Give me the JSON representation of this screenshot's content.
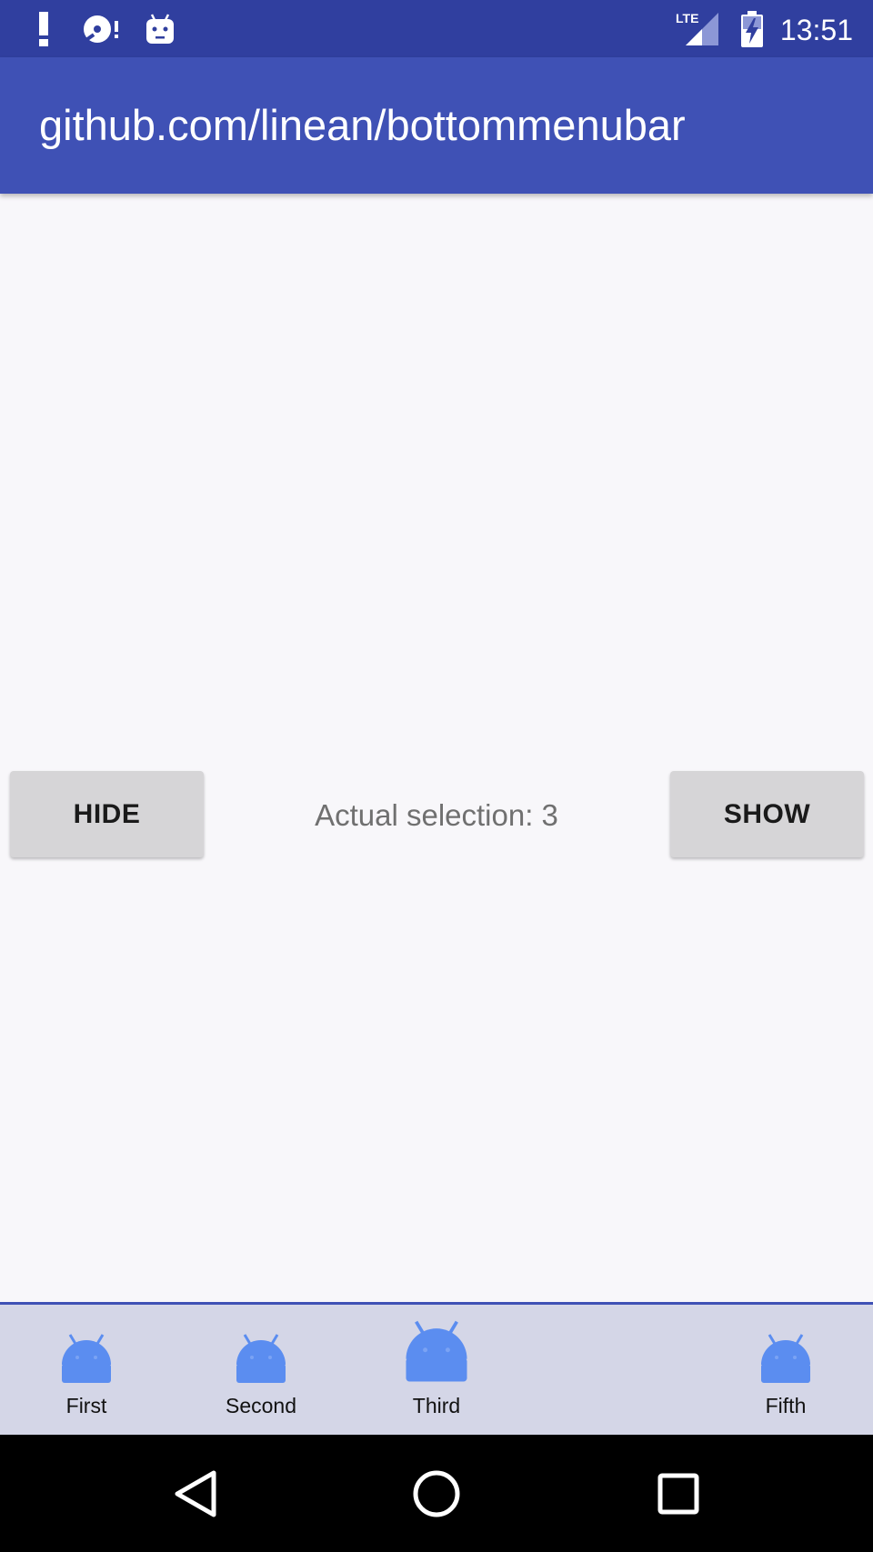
{
  "status_bar": {
    "time": "13:51",
    "network_label": "LTE",
    "icons": [
      "alert-icon",
      "sd-card-icon",
      "android-debug-icon",
      "signal-icon",
      "battery-charging-icon"
    ]
  },
  "app_bar": {
    "title": "github.com/linean/bottommenubar"
  },
  "main": {
    "hide_label": "HIDE",
    "show_label": "SHOW",
    "selection_text": "Actual selection: 3"
  },
  "bottom_menu": {
    "selected_index": 3,
    "items": [
      {
        "label": "First",
        "icon": "android-icon"
      },
      {
        "label": "Second",
        "icon": "android-icon"
      },
      {
        "label": "Third",
        "icon": "android-icon"
      },
      {
        "label": "Fifth",
        "icon": "android-icon"
      }
    ]
  },
  "nav_bar": {
    "icons": [
      "back-icon",
      "home-icon",
      "recents-icon"
    ]
  },
  "colors": {
    "status_bar": "#303f9f",
    "app_bar": "#3f51b5",
    "background": "#f8f7fa",
    "bottom_bar": "#d4d6e7",
    "icon_accent": "#5b8df0",
    "button": "#d6d5d7"
  }
}
